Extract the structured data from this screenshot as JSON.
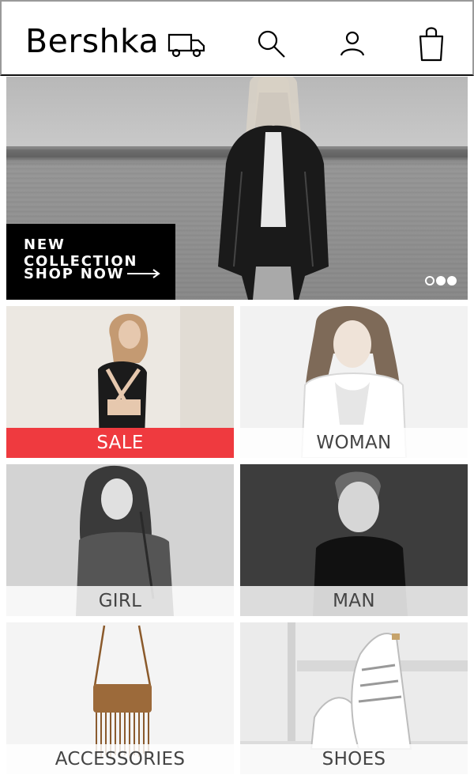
{
  "header": {
    "logo": "Bershka",
    "icons": [
      "truck-icon",
      "search-icon",
      "user-icon",
      "bag-icon"
    ]
  },
  "hero": {
    "line1": "NEW COLLECTION",
    "line2": "SHOP NOW",
    "slides": 3,
    "active_slide": 3
  },
  "tiles": [
    {
      "label": "SALE",
      "accent": "#ef3a3f"
    },
    {
      "label": "WOMAN"
    },
    {
      "label": "GIRL"
    },
    {
      "label": "MAN"
    },
    {
      "label": "ACCESSORIES"
    },
    {
      "label": "SHOES"
    }
  ],
  "colors": {
    "sale_accent": "#ef3a3f",
    "badge_bg": "#000000"
  }
}
